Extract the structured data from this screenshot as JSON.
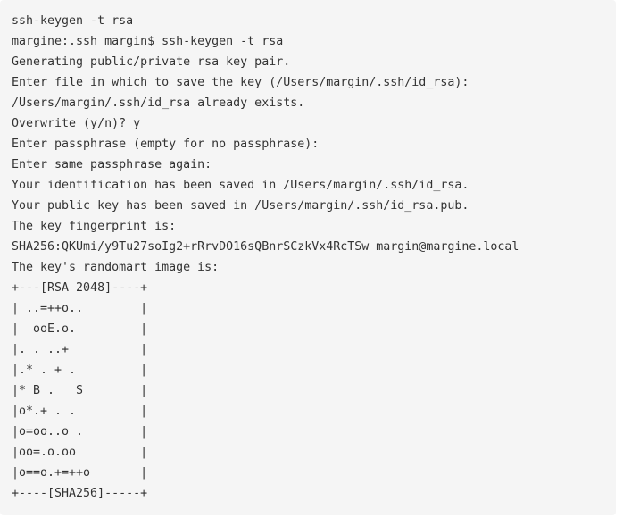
{
  "code_block": {
    "lines": [
      "ssh-keygen -t rsa",
      "margine:.ssh margin$ ssh-keygen -t rsa",
      "Generating public/private rsa key pair.",
      "Enter file in which to save the key (/Users/margin/.ssh/id_rsa):",
      "/Users/margin/.ssh/id_rsa already exists.",
      "Overwrite (y/n)? y",
      "Enter passphrase (empty for no passphrase):",
      "Enter same passphrase again:",
      "Your identification has been saved in /Users/margin/.ssh/id_rsa.",
      "Your public key has been saved in /Users/margin/.ssh/id_rsa.pub.",
      "The key fingerprint is:",
      "SHA256:QKUmi/y9Tu27soIg2+rRrvDO16sQBnrSCzkVx4RcTSw margin@margine.local",
      "The key's randomart image is:",
      "+---[RSA 2048]----+",
      "| ..=++o..        |",
      "|  ooE.o.         |",
      "|. . ..+          |",
      "|.* . + .         |",
      "|* B .   S        |",
      "|o*.+ . .         |",
      "|o=oo..o .        |",
      "|oo=.o.oo         |",
      "|o==o.+=++o       |",
      "+----[SHA256]-----+"
    ]
  }
}
